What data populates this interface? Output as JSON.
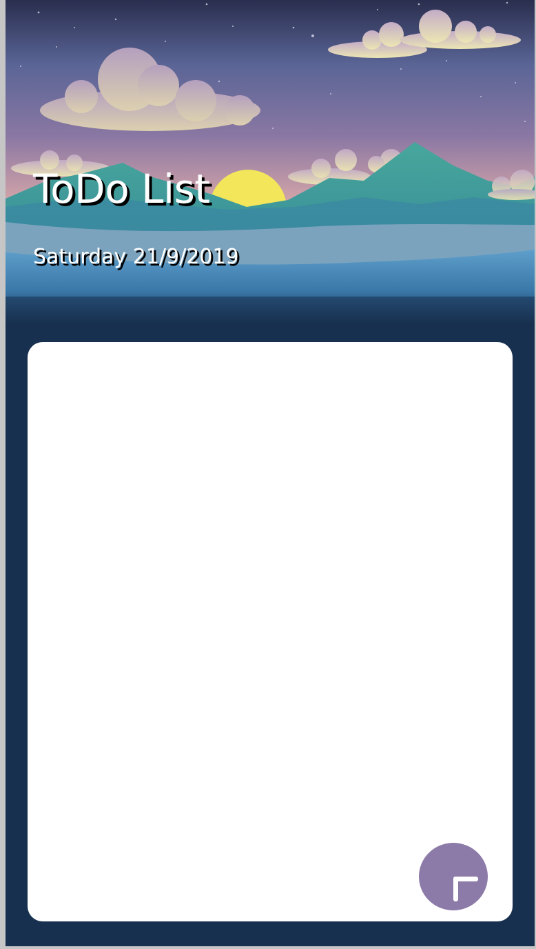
{
  "header": {
    "title": "ToDo List",
    "date": "Saturday 21/9/2019"
  },
  "todo_list": {
    "items": []
  },
  "add_button": {
    "icon": "plus-icon"
  },
  "colors": {
    "background": "#17304f",
    "card": "#ffffff",
    "accent": "#8c7aa8",
    "text": "#ffffff"
  }
}
